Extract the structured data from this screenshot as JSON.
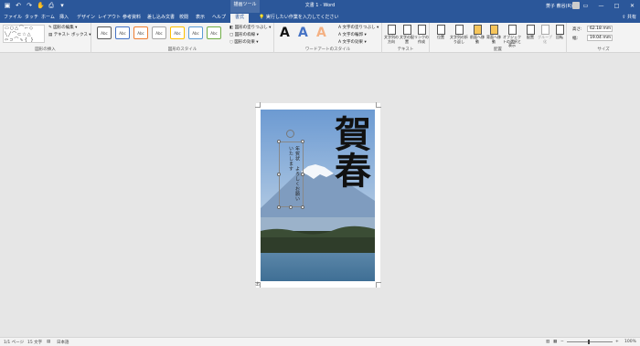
{
  "window": {
    "title": "文書 1 - Word",
    "context_tab": "描画ツール",
    "user": "菱子 薮谷(R)",
    "share": "共有"
  },
  "tabs": [
    "ファイル",
    "ホーム",
    "挿入",
    "デザイン",
    "レイアウト",
    "参考資料",
    "差し込み文書",
    "校閲",
    "表示",
    "ヘルプ",
    "書式"
  ],
  "tabs_display": [
    "ファイル",
    "タッチ",
    "ホーム",
    "挿入",
    "デザイン",
    "レイアウト",
    "参考資料",
    "差し込み文書",
    "校閲",
    "表示",
    "ヘルプ",
    "書式"
  ],
  "tellme": "実行したい作業を入力してください",
  "ribbon": {
    "insert_shapes": {
      "label": "図形の挿入",
      "edit_shape": "図形の編集",
      "text_box": "テキスト ボックス"
    },
    "shape_styles": {
      "label": "図形のスタイル",
      "sample": "Abc",
      "fill": "図形の塗りつぶし",
      "outline": "図形の枠線",
      "effects": "図形の効果",
      "style_colors": [
        "#5a5a5a",
        "#4472c4",
        "#ed7d31",
        "#a5a5a5",
        "#ffc000",
        "#5b9bd5",
        "#70ad47"
      ]
    },
    "wordart": {
      "label": "ワードアートのスタイル",
      "letters": [
        "A",
        "A",
        "A"
      ],
      "letter_colors": [
        "#111111",
        "#4472c4",
        "#f4b183"
      ],
      "fill": "文字の塗りつぶし",
      "outline": "文字の輪郭",
      "effects": "文字の効果"
    },
    "text": {
      "label": "テキスト",
      "direction": "文字列の方向",
      "align": "文字の配置",
      "link": "リンクの作成"
    },
    "arrange": {
      "label": "配置",
      "position": "位置",
      "wrap": "文字列の折り返し",
      "forward": "前面へ移動",
      "backward": "背面へ移動",
      "selection_pane": "オブジェクトの選択と表示",
      "align": "配置",
      "group": "グループ化",
      "rotate": "回転"
    },
    "size": {
      "label": "サイズ",
      "height_label": "高さ:",
      "height_value": "62.18 mm",
      "width_label": "幅:",
      "width_value": "19.04 mm"
    }
  },
  "document": {
    "card_text": "年賀状　よろしくお願いいたします",
    "kanji": "賀春"
  },
  "status": {
    "page": "1/1 ページ",
    "words": "15 文字",
    "language": "日本語",
    "zoom": "100%"
  }
}
